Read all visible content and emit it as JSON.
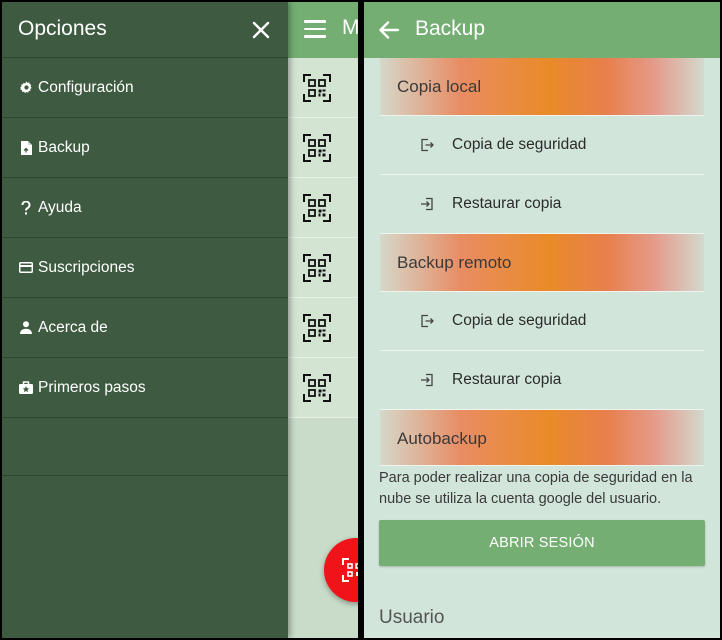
{
  "left": {
    "appbar": {
      "title": "M"
    },
    "drawer": {
      "title": "Opciones",
      "items": [
        {
          "label": "Configuración",
          "icon": "gear-icon"
        },
        {
          "label": "Backup",
          "icon": "file-icon"
        },
        {
          "label": "Ayuda",
          "icon": "question-icon"
        },
        {
          "label": "Suscripciones",
          "icon": "card-icon"
        },
        {
          "label": "Acerca de",
          "icon": "person-icon"
        },
        {
          "label": "Primeros pasos",
          "icon": "briefcase-icon"
        }
      ]
    }
  },
  "right": {
    "appbar": {
      "title": "Backup"
    },
    "sections": {
      "local": {
        "header": "Copia local",
        "backup_label": "Copia de seguridad",
        "restore_label": "Restaurar copia"
      },
      "remote": {
        "header": "Backup remoto",
        "backup_label": "Copia de seguridad",
        "restore_label": "Restaurar copia"
      },
      "auto": {
        "header": "Autobackup",
        "info": "Para poder realizar una copia de seguridad en la nube se utiliza la cuenta google del usuario.",
        "login_label": "ABRIR SESIÓN",
        "user_label": "Usuario"
      }
    }
  },
  "colors": {
    "appbar": "#74ae73",
    "drawer": "#3e5a40",
    "fab": "#f0141a",
    "section_accent": "#e98b28"
  }
}
